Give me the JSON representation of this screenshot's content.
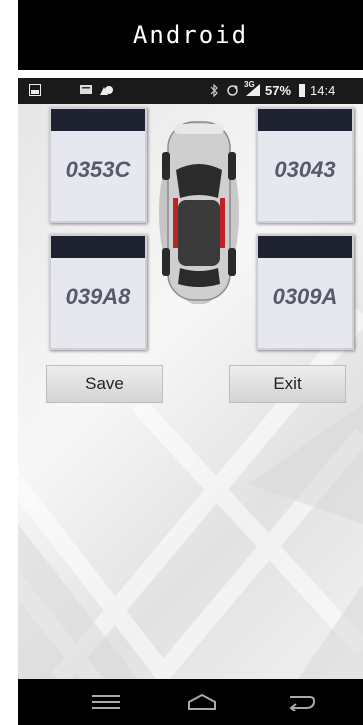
{
  "app": {
    "title": "Android"
  },
  "statusbar": {
    "network_label": "3G",
    "battery_percent": "57%",
    "time": "14:4",
    "icons": [
      "image-icon",
      "message-icon",
      "cloud-icon",
      "bluetooth-icon",
      "sync-icon",
      "signal-icon",
      "battery-icon"
    ]
  },
  "tires": {
    "front_left": {
      "code": "0353C"
    },
    "front_right": {
      "code": "03043"
    },
    "rear_left": {
      "code": "039A8"
    },
    "rear_right": {
      "code": "0309A"
    }
  },
  "buttons": {
    "save_label": "Save",
    "exit_label": "Exit"
  },
  "navbar": {
    "icons": [
      "menu-icon",
      "home-icon",
      "back-icon"
    ]
  },
  "colors": {
    "tire_header": "#1f2230",
    "tire_code": "#555b6b",
    "bar_bg": "#000000",
    "car_accent": "#c0202a"
  }
}
